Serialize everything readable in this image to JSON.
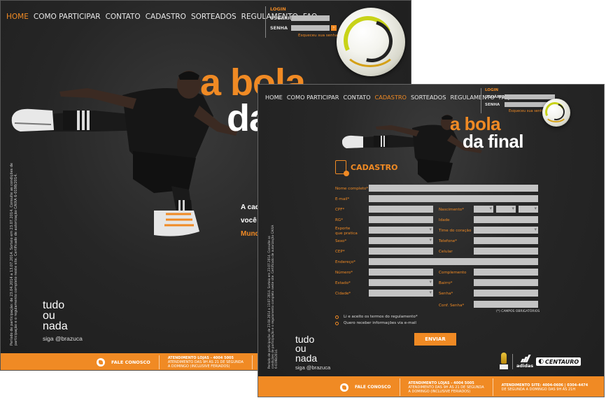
{
  "nav": {
    "items": [
      "HOME",
      "COMO PARTICIPAR",
      "CONTATO",
      "CADASTRO",
      "SORTEADOS",
      "REGULAMENTO",
      "FAQ"
    ]
  },
  "login": {
    "title": "LOGIN",
    "user_label": "USUÁRIO",
    "password_label": "SENHA",
    "go": "›",
    "forgot": "Esqueceu sua senha"
  },
  "headline": {
    "line1": "a bola",
    "line2": "da final",
    "back_line2": "da"
  },
  "tagline": {
    "line1": "A cad",
    "line2": "você",
    "line3": "Mund"
  },
  "legal": "Período de participação: de 23.04.2014 a 13.07.2014. Sorteio em 23.07.2014. Consulte as condições de participação e o regulamento completo neste site. Certificado de autorização CAIXA 6-0198/2014.",
  "brand": {
    "w1": "tudo",
    "w2": "ou",
    "w3": "nada",
    "sub": "siga @brazuca"
  },
  "footer": {
    "fale": "FALE CONOSCO",
    "att_title": "ATENDIMENTO LOJAS - 4004 5005",
    "att_line2": "ATENDIMENTO DAS 9H ÀS 21 DE SEGUNDA",
    "att_line3": "A DOMINGO (INCLUSIVE FERIADOS)",
    "att2_title": "ATENDIMENTO SITE: 4004-0606 | 0304-4474",
    "att2_line2": "DE SEGUNDA A DOMINGO DAS 9H ÀS 21H"
  },
  "form": {
    "title": "CADASTRO",
    "labels": {
      "nome": "Nome completo*",
      "email": "E-mail*",
      "cpf": "CPF*",
      "nascimento": "Nascimento*",
      "rg": "RG*",
      "idade": "Idade",
      "esporte": "Esporte",
      "esporte2": "que pratica",
      "time": "Time do coração",
      "sexo": "Sexo*",
      "telefone": "Telefone*",
      "cep": "CEP*",
      "celular": "Celular",
      "endereco": "Endereço*",
      "numero": "Número*",
      "complemento": "Complemento",
      "estado": "Estado*",
      "bairro": "Bairro*",
      "cidade": "Cidade*",
      "senha": "Senha*",
      "conf_senha": "Conf. Senha*"
    },
    "required_note": "(*) CAMPOS OBRIGATÓRIOS",
    "check_terms": "Li e aceito os termos do regulamento*",
    "check_news": "Quero receber informações via e-mail",
    "submit": "ENVIAR"
  },
  "sponsors": {
    "adidas": "adidas",
    "centauro": "CENTAURO"
  },
  "colors": {
    "accent": "#f08a24",
    "background": "#222222",
    "field": "#c4c4c4"
  }
}
